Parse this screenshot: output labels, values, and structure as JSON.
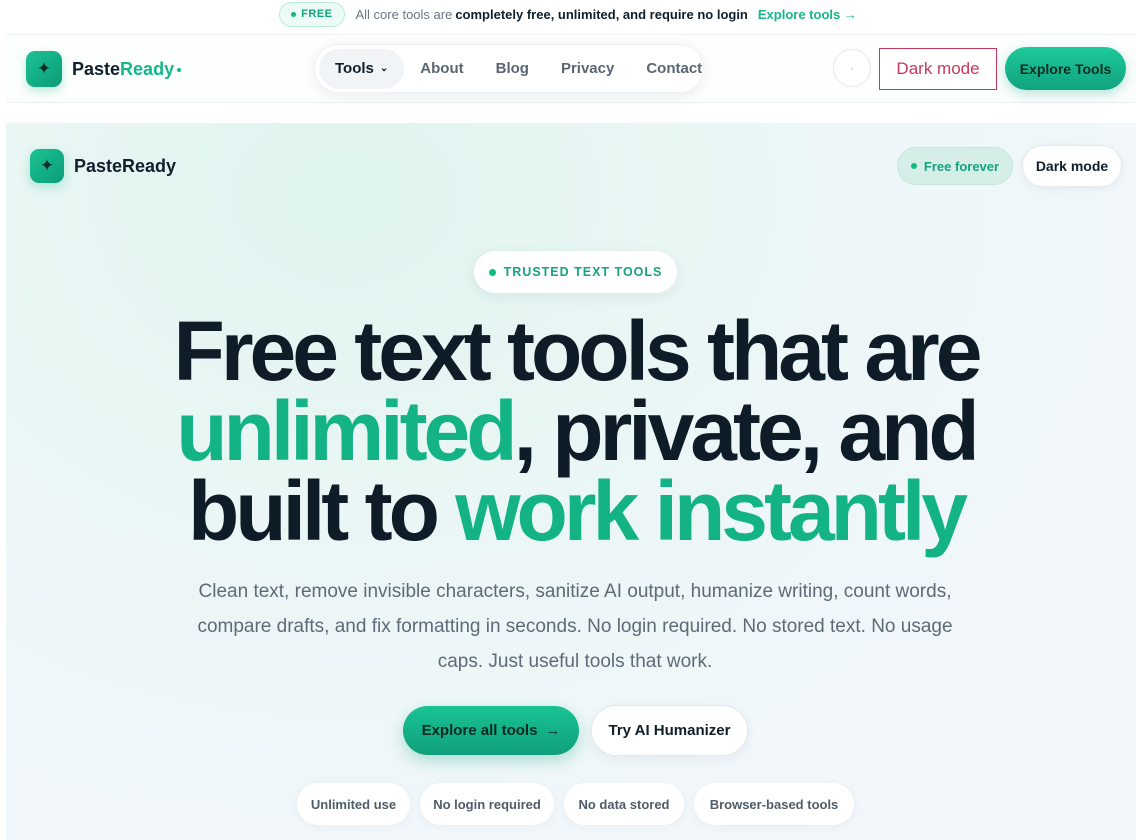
{
  "announcement": {
    "badge": "FREE",
    "text": "All core tools are",
    "emphasis": "completely free, unlimited, and require no login",
    "link": "Explore tools →"
  },
  "topnav": {
    "brand": {
      "name_part1": "Paste",
      "name_part2": "Ready",
      "logo_icon": "✦"
    },
    "links": [
      {
        "label": "Tools",
        "has_dropdown": true,
        "active": true
      },
      {
        "label": "About"
      },
      {
        "label": "Blog"
      },
      {
        "label": "Privacy"
      },
      {
        "label": "Contact"
      }
    ],
    "dropdown_icon": "⌄",
    "circle_icon": "◦",
    "dark_mode_label": "Dark mode",
    "explore_label": "Explore Tools"
  },
  "hero_header": {
    "brand_name": "PasteReady",
    "logo_icon": "✦",
    "free_badge": "Free forever",
    "dark_mode_label": "Dark mode"
  },
  "hero": {
    "eyebrow": "TRUSTED TEXT TOOLS",
    "headline": {
      "line1": "Free text tools that are",
      "line2_green": "unlimited",
      "line2_rest": ", private, and",
      "line3_start": "built to ",
      "line3_green": "work instantly"
    },
    "subtitle": "Clean text, remove invisible characters, sanitize AI output, humanize writing, count words, compare drafts, and fix formatting in seconds. No login required. No stored text. No usage caps. Just useful tools that work.",
    "cta_primary": "Explore all tools",
    "cta_primary_arrow": "→",
    "cta_secondary": "Try AI Humanizer",
    "chips": [
      "Unlimited use",
      "No login required",
      "No data stored",
      "Browser-based tools"
    ]
  },
  "colors": {
    "accent": "#13b386",
    "dark_text": "#0e1c27",
    "muted_text": "#5d6b78",
    "dark_mode_outline": "#c8375d"
  }
}
